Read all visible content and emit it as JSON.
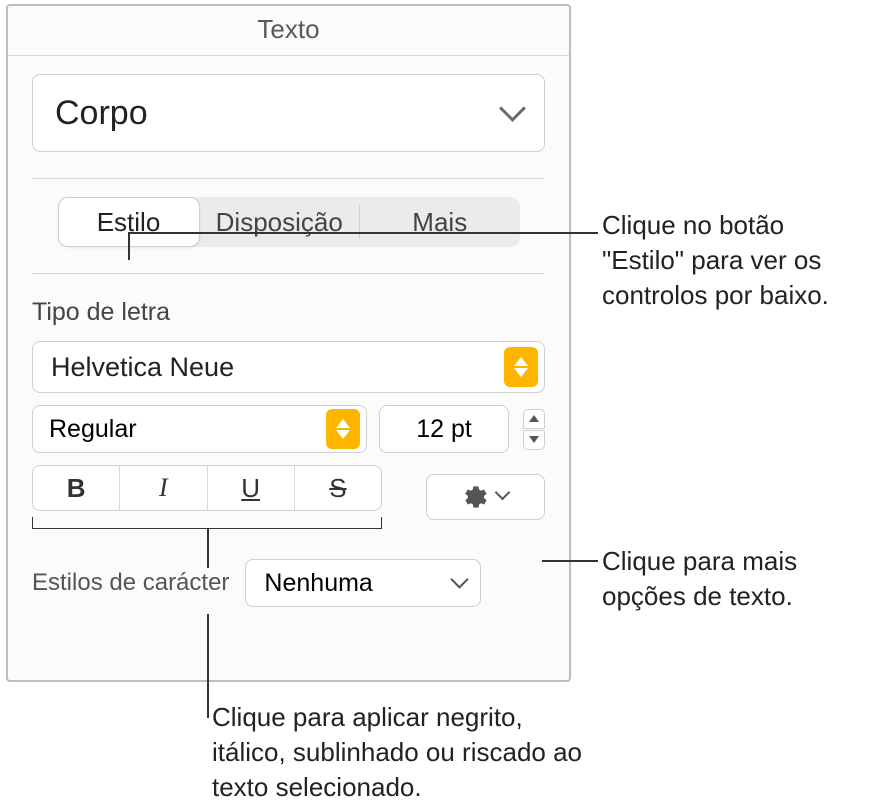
{
  "header": {
    "title": "Texto"
  },
  "paragraph_style": {
    "value": "Corpo"
  },
  "tabs": {
    "style": "Estilo",
    "layout": "Disposição",
    "more": "Mais"
  },
  "font_section": {
    "label": "Tipo de letra",
    "family": "Helvetica Neue",
    "weight": "Regular",
    "size": "12 pt",
    "bold_glyph": "B",
    "italic_glyph": "I",
    "underline_glyph": "U",
    "strike_glyph": "S"
  },
  "char_styles": {
    "label": "Estilos de carácter",
    "value": "Nenhuma"
  },
  "callouts": {
    "style_tab": "Clique no botão \"Estilo\" para ver os controlos por baixo.",
    "advanced": "Clique para mais opções de texto.",
    "bius": "Clique para aplicar negrito, itálico, sublinhado ou riscado ao texto selecionado."
  }
}
